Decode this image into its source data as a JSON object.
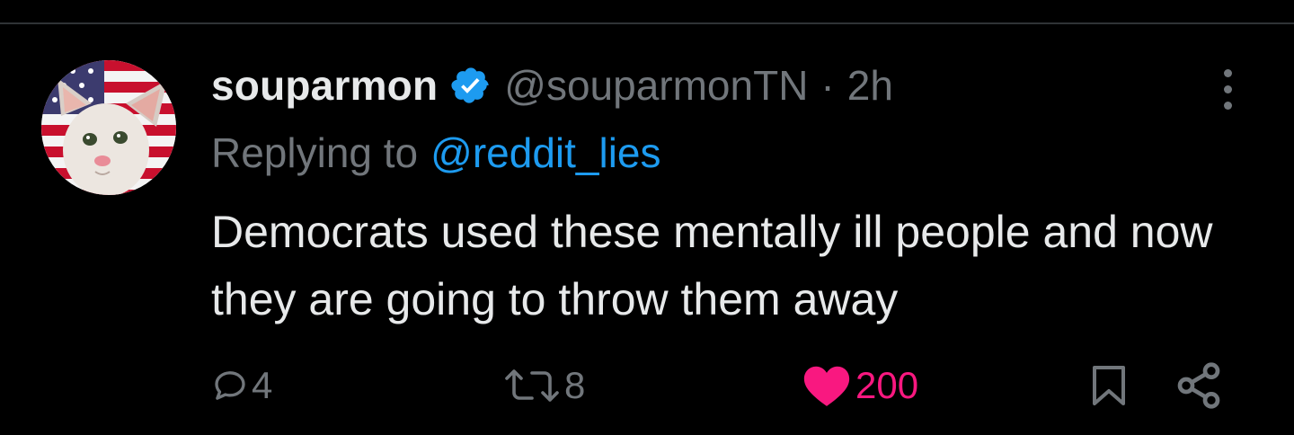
{
  "tweet": {
    "display_name": "souparmon",
    "handle": "@souparmonTN",
    "separator": "·",
    "timestamp": "2h",
    "replying_prefix": "Replying to",
    "replying_to": "@reddit_lies",
    "text": "Democrats used these mentally ill people and now they are going to throw them away",
    "verified": true
  },
  "actions": {
    "replies": "4",
    "retweets": "8",
    "likes": "200",
    "liked": true
  },
  "icons": {
    "verified": "verified-badge-icon",
    "more": "more-options-icon",
    "reply": "reply-icon",
    "retweet": "retweet-icon",
    "like": "heart-icon",
    "bookmark": "bookmark-icon",
    "share": "share-icon"
  },
  "colors": {
    "background": "#000000",
    "primary_text": "#e7e9ea",
    "secondary_text": "#71767b",
    "link": "#1d9bf0",
    "like": "#f91880",
    "divider": "#2f3336"
  }
}
